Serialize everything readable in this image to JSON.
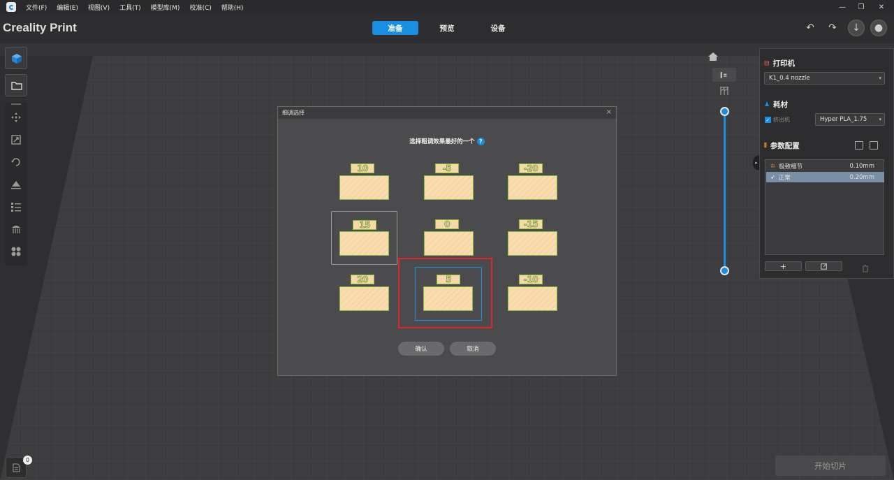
{
  "menu": {
    "items": [
      "文件(F)",
      "编辑(E)",
      "视图(V)",
      "工具(T)",
      "模型库(M)",
      "校准(C)",
      "帮助(H)"
    ]
  },
  "header": {
    "brand": "Creality Print",
    "tabs": [
      "准备",
      "预览",
      "设备"
    ],
    "active_tab": "准备"
  },
  "right_panel": {
    "printer_title": "打印机",
    "printer_value": "K1_0.4 nozzle",
    "filament_title": "耗材",
    "extruder_label": "挤出机",
    "filament_value": "Hyper PLA_1.75",
    "params_title": "参数配置",
    "profiles": [
      {
        "name": "极致细节",
        "value": "0.10mm"
      },
      {
        "name": "正常",
        "value": "0.20mm"
      }
    ],
    "selected_profile": "正常",
    "add_label": "+"
  },
  "slice_button": "开始切片",
  "object_count": "0",
  "dialog": {
    "title": "细调选择",
    "prompt": "选择粗调效果最好的一个",
    "help": "?",
    "options": [
      "10",
      "-5",
      "-20",
      "15",
      "0",
      "-15",
      "20",
      "5",
      "-10"
    ],
    "hovered": "15",
    "selected": "5",
    "confirm": "确认",
    "cancel": "取消",
    "close": "×"
  },
  "colors": {
    "accent": "#1a8ee0",
    "highlight": "#e0262c",
    "sample_fill": "#f7d8a8",
    "sample_edge": "#8ac040"
  }
}
